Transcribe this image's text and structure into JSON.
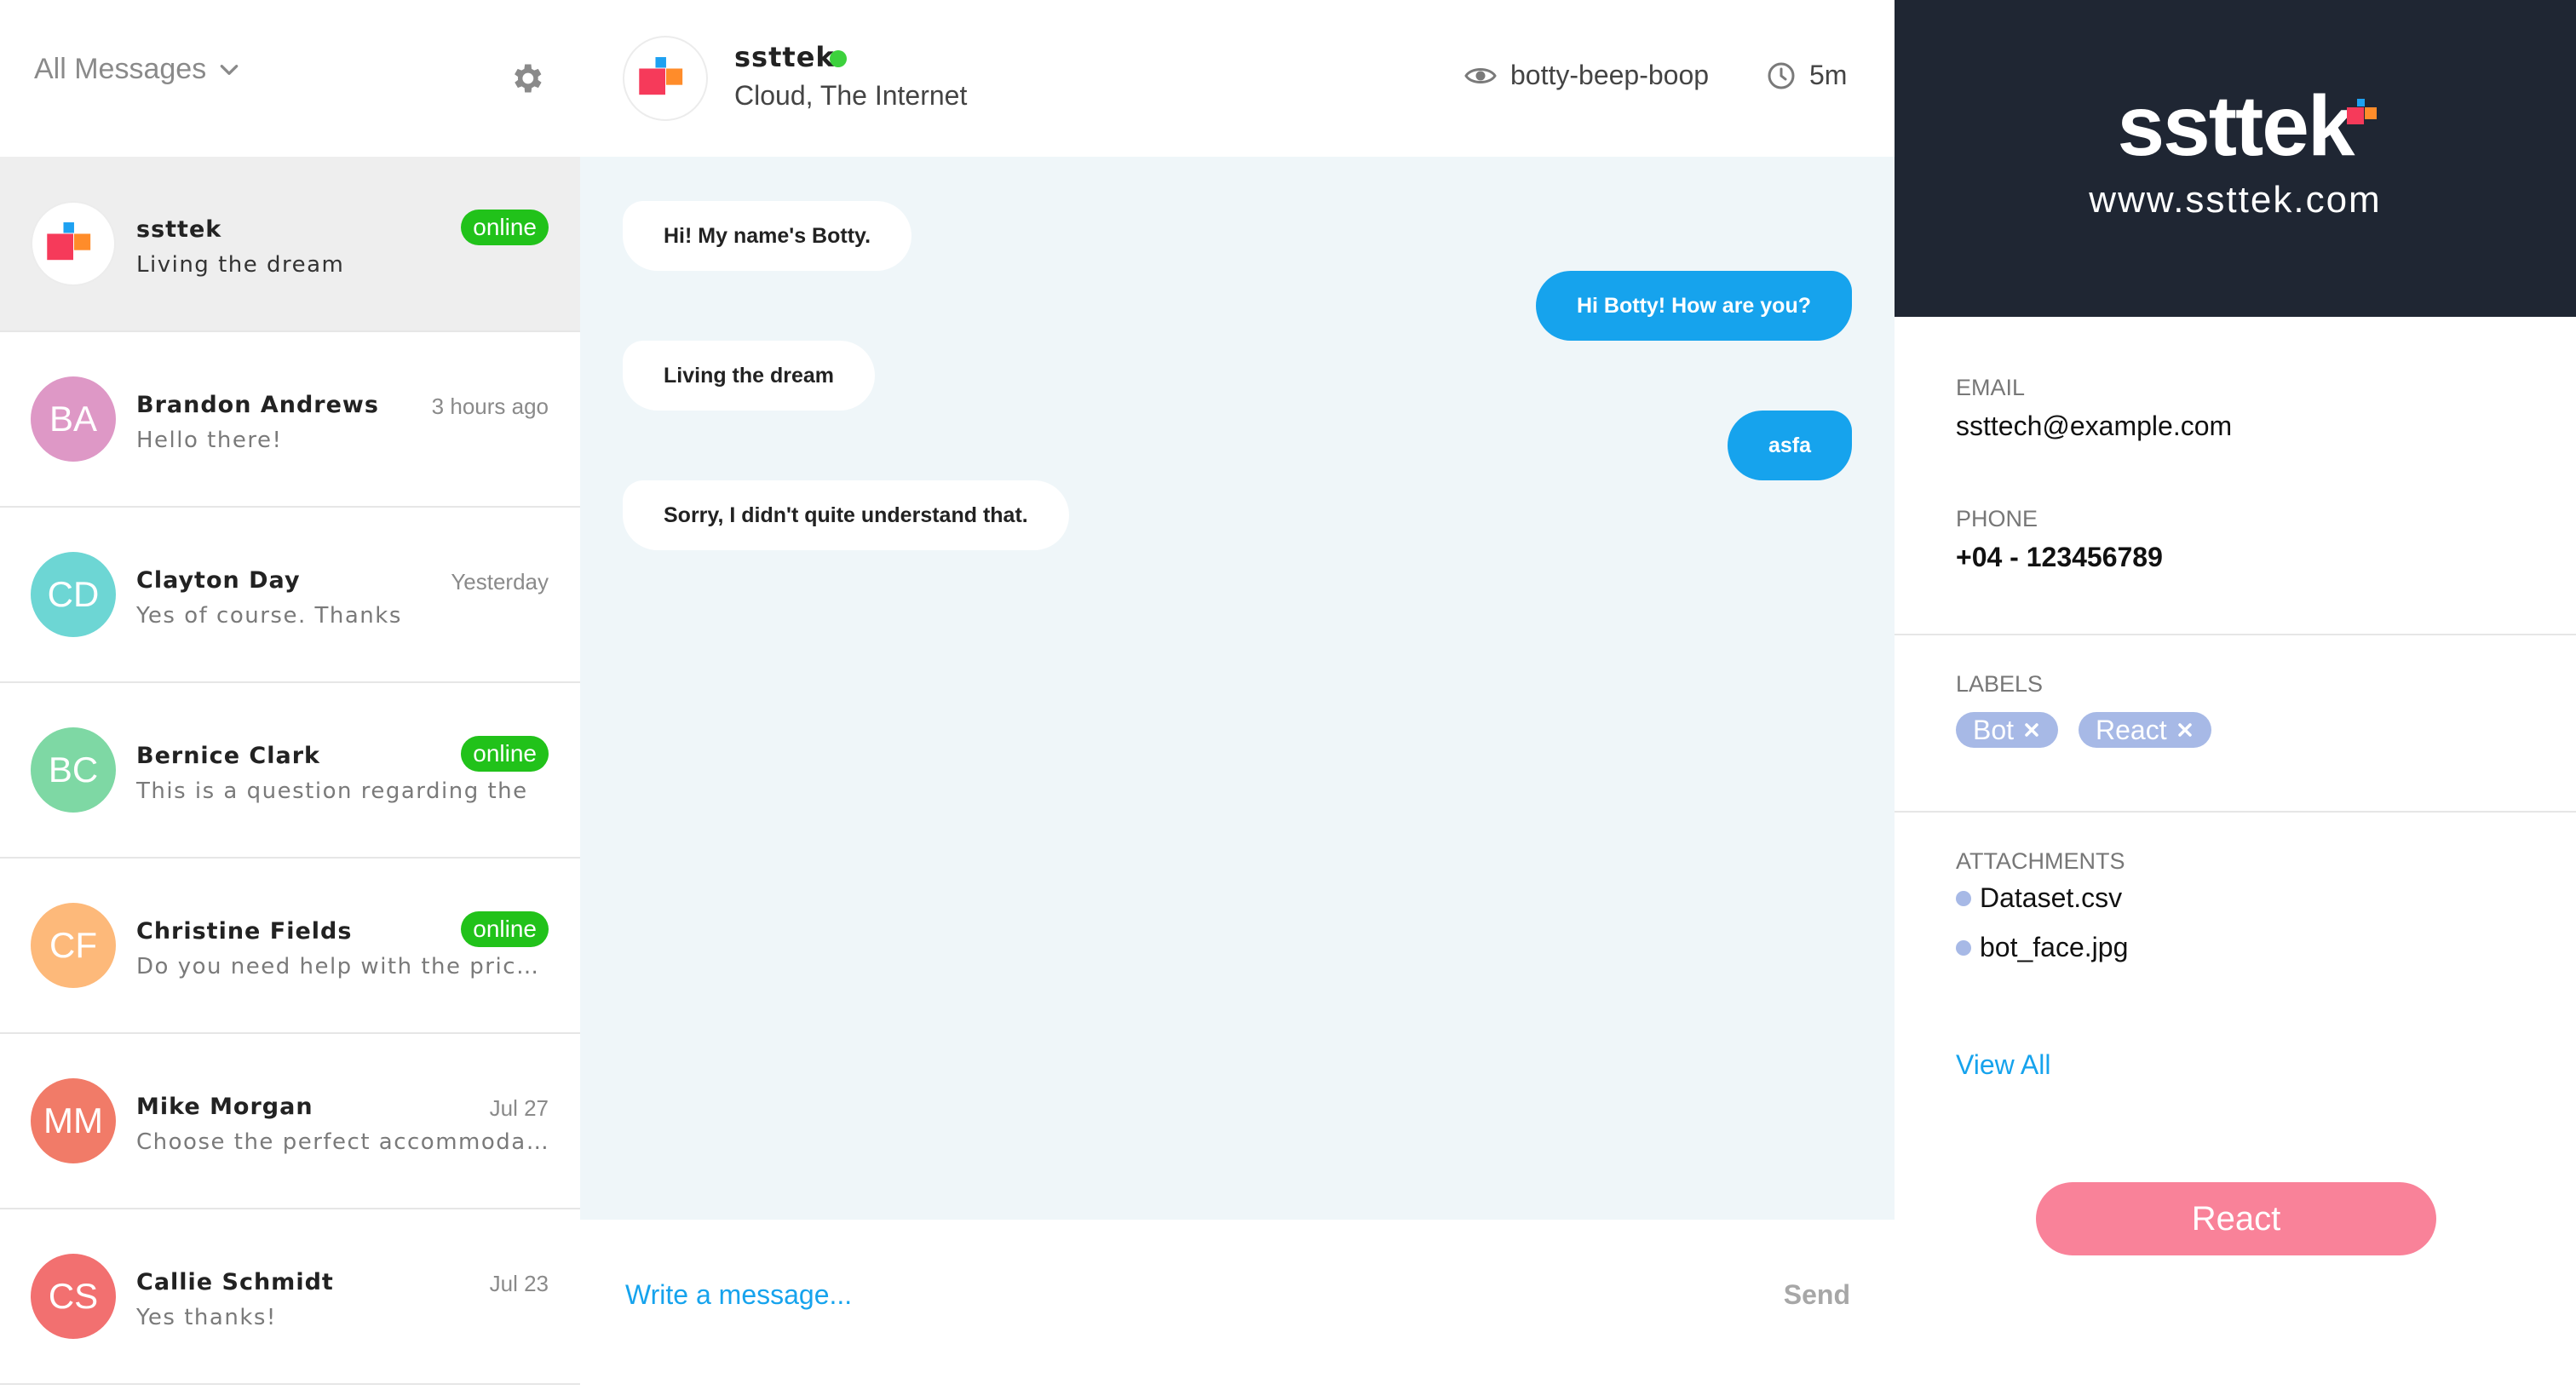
{
  "sidebar": {
    "filter_label": "All Messages",
    "conversations": [
      {
        "initials": "",
        "name": "ssttek",
        "preview": "Living the dream",
        "time": "",
        "badge": "online",
        "color": "#ffffff"
      },
      {
        "initials": "BA",
        "name": "Brandon Andrews",
        "preview": "Hello there!",
        "time": "3 hours ago",
        "badge": "",
        "color": "#de98c6"
      },
      {
        "initials": "CD",
        "name": "Clayton Day",
        "preview": "Yes of course. Thanks",
        "time": "Yesterday",
        "badge": "",
        "color": "#6dd6d4"
      },
      {
        "initials": "BC",
        "name": "Bernice Clark",
        "preview": "This is a question regarding the",
        "time": "",
        "badge": "online",
        "color": "#7ed8a4"
      },
      {
        "initials": "CF",
        "name": "Christine Fields",
        "preview": "Do you need help with the price? Do you want to know more about this product?",
        "time": "",
        "badge": "online",
        "color": "#fdb97a"
      },
      {
        "initials": "MM",
        "name": "Mike Morgan",
        "preview": "Choose the perfect accommodation for your stay",
        "time": "Jul 27",
        "badge": "",
        "color": "#f17b68"
      },
      {
        "initials": "CS",
        "name": "Callie Schmidt",
        "preview": "Yes thanks!",
        "time": "Jul 23",
        "badge": "",
        "color": "#f27070"
      }
    ]
  },
  "chat": {
    "name": "ssttek",
    "location": "Cloud, The Internet",
    "watcher": "botty-beep-boop",
    "timer": "5m",
    "messages": [
      {
        "dir": "in",
        "text": "Hi! My name's Botty."
      },
      {
        "dir": "out",
        "text": "Hi Botty! How are you?"
      },
      {
        "dir": "in",
        "text": "Living the dream"
      },
      {
        "dir": "out",
        "text": "asfa"
      },
      {
        "dir": "in",
        "text": "Sorry, I didn't quite understand that."
      }
    ],
    "composer_placeholder": "Write a message...",
    "send_label": "Send"
  },
  "panel": {
    "brand_name": "ssttek",
    "brand_url": "www.ssttek.com",
    "email_label": "EMAIL",
    "email": "ssttech@example.com",
    "phone_label": "PHONE",
    "phone": "+04 - 123456789",
    "labels_label": "LABELS",
    "labels": [
      "Bot",
      "React"
    ],
    "attachments_label": "ATTACHMENTS",
    "attachments": [
      "Dataset.csv",
      "bot_face.jpg"
    ],
    "view_all": "View All",
    "react_button": "React"
  },
  "colors": {
    "brand_dark": "#1f2633",
    "accent_blue": "#16a3ed",
    "online_green": "#21c21a",
    "tag_blue": "#a7b9e6",
    "react_pink": "#f98299",
    "chat_bg": "#eff6f9",
    "logo_red": "#f63a5a",
    "logo_orange": "#ff8c2a",
    "logo_blue": "#1ea1f1"
  }
}
